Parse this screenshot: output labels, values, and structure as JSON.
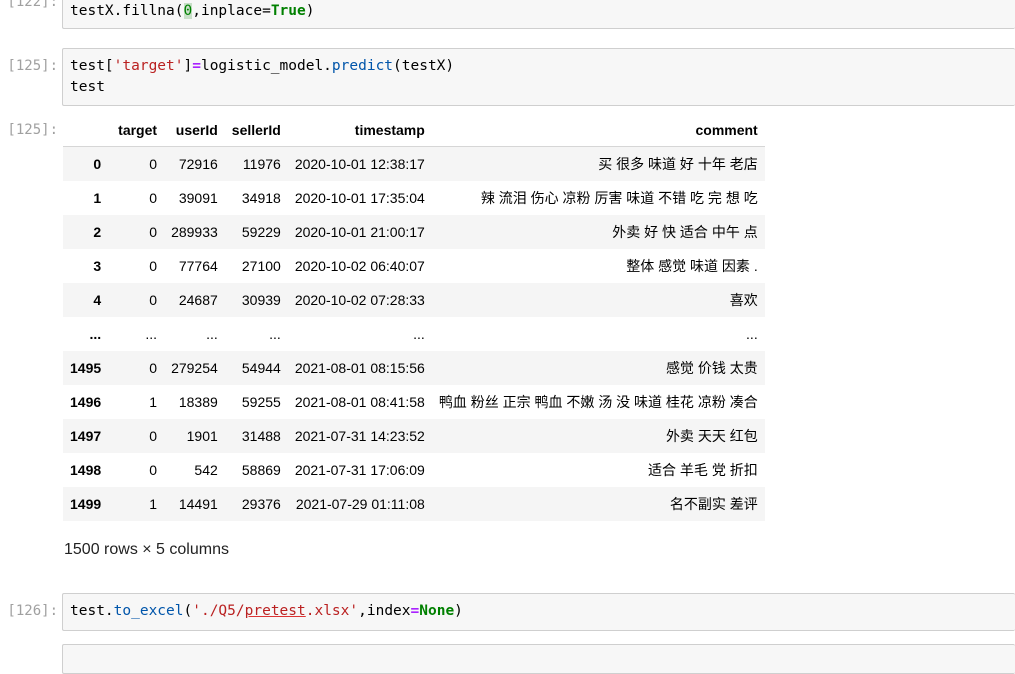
{
  "cells": {
    "prev": {
      "prompt": "[122]:",
      "code_parts": [
        "testX.fillna(",
        "0",
        ",inplace=",
        "True",
        ")"
      ]
    },
    "c125_in": {
      "prompt": "[125]:",
      "line1": [
        "test[",
        "'target'",
        "]",
        "=",
        "logistic_model.",
        "predict",
        "(testX)"
      ],
      "line2": "test"
    },
    "c125_out": {
      "prompt": "[125]:"
    },
    "c126_in": {
      "prompt": "[126]:",
      "line1": [
        "test.",
        "to_excel",
        "(",
        "'./Q5/",
        "pretest",
        ".xlsx'",
        ",index",
        "=",
        "None",
        ")"
      ]
    }
  },
  "dataframe": {
    "columns": [
      "",
      "target",
      "userId",
      "sellerId",
      "timestamp",
      "comment"
    ],
    "rows": [
      [
        "0",
        "0",
        "72916",
        "11976",
        "2020-10-01 12:38:17",
        "买 很多 味道 好 十年 老店"
      ],
      [
        "1",
        "0",
        "39091",
        "34918",
        "2020-10-01 17:35:04",
        "辣 流泪 伤心 凉粉 厉害 味道 不错 吃 完 想 吃"
      ],
      [
        "2",
        "0",
        "289933",
        "59229",
        "2020-10-01 21:00:17",
        "外卖 好 快 适合 中午 点"
      ],
      [
        "3",
        "0",
        "77764",
        "27100",
        "2020-10-02 06:40:07",
        "整体 感觉 味道 因素 ."
      ],
      [
        "4",
        "0",
        "24687",
        "30939",
        "2020-10-02 07:28:33",
        "喜欢"
      ],
      [
        "...",
        "...",
        "...",
        "...",
        "...",
        "..."
      ],
      [
        "1495",
        "0",
        "279254",
        "54944",
        "2021-08-01 08:15:56",
        "感觉 价钱 太贵"
      ],
      [
        "1496",
        "1",
        "18389",
        "59255",
        "2021-08-01 08:41:58",
        "鸭血 粉丝 正宗 鸭血 不嫩 汤 没 味道 桂花 凉粉 凑合"
      ],
      [
        "1497",
        "0",
        "1901",
        "31488",
        "2021-07-31 14:23:52",
        "外卖 天天 红包"
      ],
      [
        "1498",
        "0",
        "542",
        "58869",
        "2021-07-31 17:06:09",
        "适合 羊毛 党 折扣"
      ],
      [
        "1499",
        "1",
        "14491",
        "29376",
        "2021-07-29 01:11:08",
        "名不副实 差评"
      ]
    ],
    "shape": "1500 rows × 5 columns"
  }
}
